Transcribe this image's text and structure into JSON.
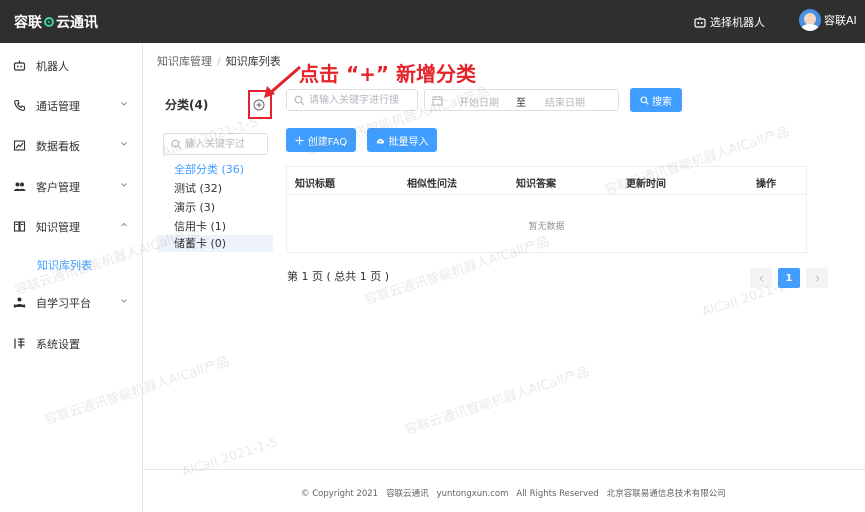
{
  "header": {
    "logo_left": "容联",
    "logo_right": "云通讯",
    "robot_select_label": "选择机器人",
    "user_name": "容联AI"
  },
  "sidebar": {
    "items": [
      {
        "label": "机器人",
        "icon": "robot-icon"
      },
      {
        "label": "通话管理",
        "icon": "phone-icon",
        "expandable": true
      },
      {
        "label": "数据看板",
        "icon": "chart-icon",
        "expandable": true
      },
      {
        "label": "客户管理",
        "icon": "people-icon",
        "expandable": true
      },
      {
        "label": "知识管理",
        "icon": "book-icon",
        "expandable": true,
        "expanded": true
      },
      {
        "label": "自学习平台",
        "icon": "learning-icon",
        "expandable": true
      },
      {
        "label": "系统设置",
        "icon": "settings-icon"
      }
    ],
    "sub_item": "知识库列表"
  },
  "breadcrumb": {
    "parent": "知识库管理",
    "sep": "/",
    "current": "知识库列表"
  },
  "annotation": {
    "text": "点击 “+” 新增分类",
    "color": "#e4232a"
  },
  "category": {
    "title": "分类(4)",
    "search_placeholder": "输入关键字过",
    "items": [
      {
        "label": "全部分类 (36)"
      },
      {
        "label": "测试 (32)"
      },
      {
        "label": "演示 (3)"
      },
      {
        "label": "信用卡 (1)"
      },
      {
        "label": "储蓄卡 (0)"
      }
    ]
  },
  "filters": {
    "keyword_placeholder": "请输入关键字进行搜",
    "start_date_placeholder": "开始日期",
    "range_separator": "至",
    "end_date_placeholder": "结束日期",
    "search_button": "搜索"
  },
  "actions": {
    "create_faq": "创建FAQ",
    "batch_import": "批量导入"
  },
  "table": {
    "columns": [
      "知识标题",
      "相似性问法",
      "知识答案",
      "更新时间",
      "操作"
    ],
    "empty_text": "暂无数据"
  },
  "pagination": {
    "info": "第 1 页 ( 总共 1 页 )",
    "current_page": "1"
  },
  "footer": {
    "copyright": "© Copyright 2021",
    "brand": "容联云通讯",
    "domain": "yuntongxun.com",
    "rights": "All Rights Reserved",
    "company": "北京容联易通信息技术有限公司"
  },
  "watermark": {
    "text": "容联云通讯智能机器人AICall产品",
    "short": "AICall 2021-1-5"
  },
  "colors": {
    "primary": "#409eff",
    "topbar": "#2f2f2f",
    "annotation": "#e4232a"
  }
}
